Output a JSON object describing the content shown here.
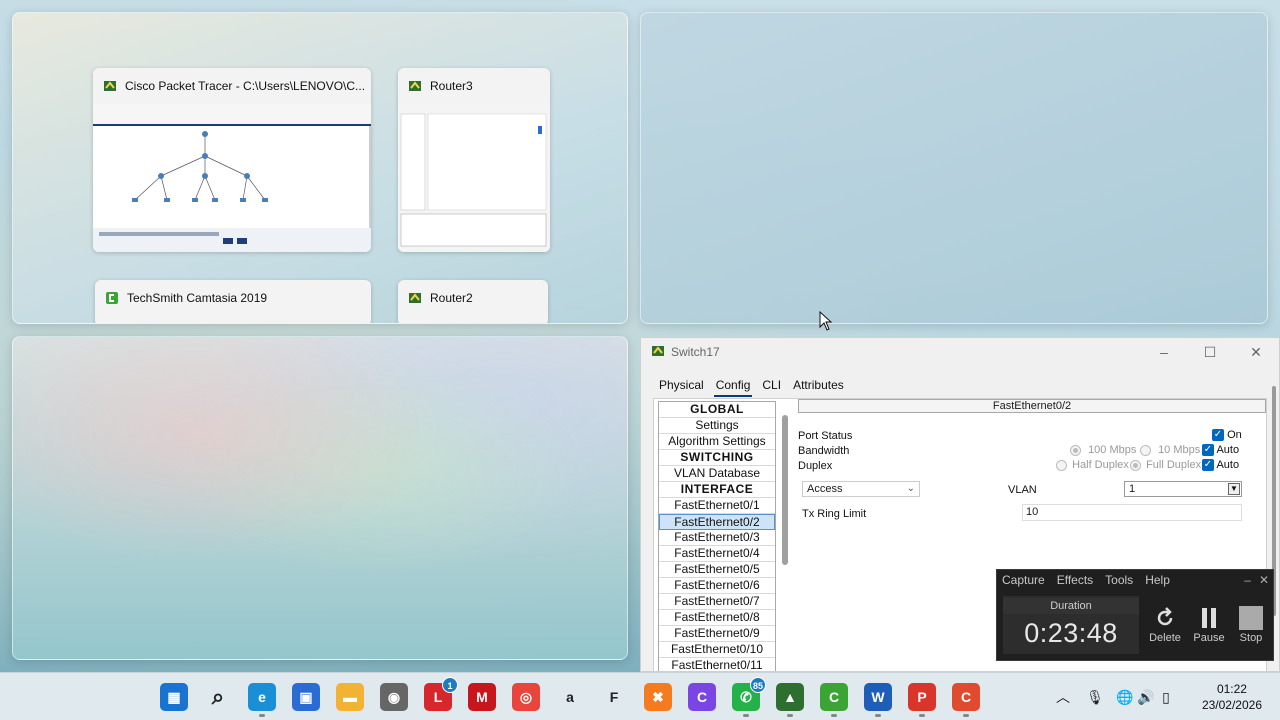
{
  "snap_assist": {
    "windows": [
      {
        "title": "Cisco Packet Tracer - C:\\Users\\LENOVO\\C...",
        "icon": "packet-tracer-icon"
      },
      {
        "title": "Router3",
        "icon": "packet-tracer-icon"
      },
      {
        "title": "TechSmith Camtasia 2019",
        "icon": "camtasia-icon"
      },
      {
        "title": "Router2",
        "icon": "packet-tracer-icon"
      }
    ]
  },
  "switch_window": {
    "title": "Switch17",
    "controls": {
      "minimize": "–",
      "maximize": "☐",
      "close": "✕"
    },
    "tabs": [
      "Physical",
      "Config",
      "CLI",
      "Attributes"
    ],
    "active_tab": "Config",
    "sidebar": [
      {
        "label": "GLOBAL",
        "type": "header"
      },
      {
        "label": "Settings",
        "type": "item"
      },
      {
        "label": "Algorithm Settings",
        "type": "item"
      },
      {
        "label": "SWITCHING",
        "type": "header"
      },
      {
        "label": "VLAN Database",
        "type": "item"
      },
      {
        "label": "INTERFACE",
        "type": "header"
      },
      {
        "label": "FastEthernet0/1",
        "type": "item"
      },
      {
        "label": "FastEthernet0/2",
        "type": "selected"
      },
      {
        "label": "FastEthernet0/3",
        "type": "item"
      },
      {
        "label": "FastEthernet0/4",
        "type": "item"
      },
      {
        "label": "FastEthernet0/5",
        "type": "item"
      },
      {
        "label": "FastEthernet0/6",
        "type": "item"
      },
      {
        "label": "FastEthernet0/7",
        "type": "item"
      },
      {
        "label": "FastEthernet0/8",
        "type": "item"
      },
      {
        "label": "FastEthernet0/9",
        "type": "item"
      },
      {
        "label": "FastEthernet0/10",
        "type": "item"
      },
      {
        "label": "FastEthernet0/11",
        "type": "item"
      }
    ],
    "panel": {
      "heading": "FastEthernet0/2",
      "port_status_label": "Port Status",
      "port_status_on_label": "On",
      "bandwidth_label": "Bandwidth",
      "bandwidth_100": "100 Mbps",
      "bandwidth_10": "10 Mbps",
      "bandwidth_auto_label": "Auto",
      "duplex_label": "Duplex",
      "duplex_half": "Half Duplex",
      "duplex_full": "Full Duplex",
      "duplex_auto_label": "Auto",
      "mode_value": "Access",
      "vlan_label": "VLAN",
      "vlan_value": "1",
      "tx_ring_label": "Tx Ring Limit",
      "tx_ring_value": "10"
    }
  },
  "recorder": {
    "menu": [
      "Capture",
      "Effects",
      "Tools",
      "Help"
    ],
    "duration_label": "Duration",
    "duration": "0:23:48",
    "buttons": [
      {
        "label": "Delete",
        "icon": "delete-restart-icon"
      },
      {
        "label": "Pause",
        "icon": "pause-icon"
      },
      {
        "label": "Stop",
        "icon": "stop-icon"
      }
    ]
  },
  "taskbar": {
    "apps": [
      {
        "name": "start",
        "icon": "windows-start-icon",
        "color": "#1a73d0"
      },
      {
        "name": "search",
        "icon": "search-icon",
        "color": "#222222"
      },
      {
        "name": "edge",
        "icon": "edge-icon",
        "color": "#1b8fd6"
      },
      {
        "name": "store",
        "icon": "store-icon",
        "color": "#2b6cd4"
      },
      {
        "name": "explorer",
        "icon": "folder-icon",
        "color": "#f2b233"
      },
      {
        "name": "camera",
        "icon": "camera-icon",
        "color": "#666666"
      },
      {
        "name": "l-app",
        "icon": "l-app-icon",
        "color": "#d7262c",
        "badge": "1"
      },
      {
        "name": "mcafee",
        "icon": "shield-icon",
        "color": "#c8161d"
      },
      {
        "name": "chrome",
        "icon": "chrome-icon",
        "color": "#e8453c"
      },
      {
        "name": "a-app",
        "icon": "a-app-icon",
        "color": "#222222"
      },
      {
        "name": "figma",
        "icon": "figma-icon",
        "color": "#222222"
      },
      {
        "name": "xampp",
        "icon": "xampp-icon",
        "color": "#f57b20"
      },
      {
        "name": "canva",
        "icon": "canva-icon",
        "color": "#7b45e3"
      },
      {
        "name": "whatsapp",
        "icon": "whatsapp-icon",
        "color": "#25b14a",
        "badge": "85"
      },
      {
        "name": "packet-tracer",
        "icon": "packet-tracer-icon",
        "color": "#2d6f2f"
      },
      {
        "name": "camtasia",
        "icon": "camtasia-icon",
        "color": "#3aa534"
      },
      {
        "name": "word",
        "icon": "word-icon",
        "color": "#1d5fb8"
      },
      {
        "name": "pdf",
        "icon": "pdf-icon",
        "color": "#d9352a"
      },
      {
        "name": "camtasia-recorder",
        "icon": "recorder-icon",
        "color": "#e04a2f"
      }
    ],
    "time": "01:22",
    "date": "23/02/2026"
  }
}
